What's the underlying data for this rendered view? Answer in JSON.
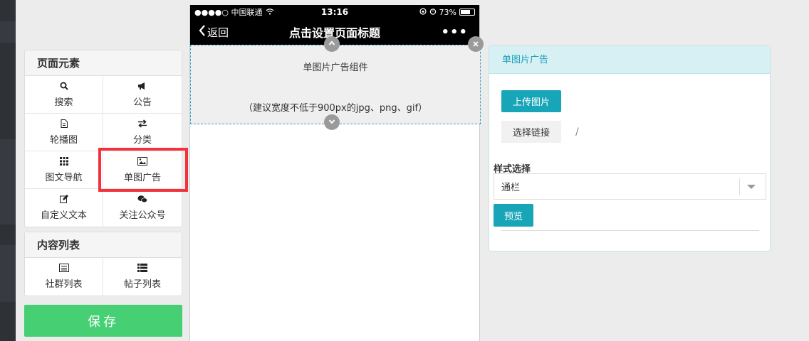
{
  "left_panel": {
    "section1_title": "页面元素",
    "section1_items": [
      {
        "label": "搜索",
        "icon": "search-icon"
      },
      {
        "label": "公告",
        "icon": "megaphone-icon"
      },
      {
        "label": "轮播图",
        "icon": "file-icon"
      },
      {
        "label": "分类",
        "icon": "exchange-icon"
      },
      {
        "label": "图文导航",
        "icon": "grid-icon"
      },
      {
        "label": "单图广告",
        "icon": "image-icon"
      },
      {
        "label": "自定义文本",
        "icon": "edit-icon"
      },
      {
        "label": "关注公众号",
        "icon": "wechat-icon"
      }
    ],
    "section2_title": "内容列表",
    "section2_items": [
      {
        "label": "社群列表",
        "icon": "list-alt-icon"
      },
      {
        "label": "帖子列表",
        "icon": "list-icon"
      }
    ],
    "save_label": "保存"
  },
  "phone": {
    "carrier": "●●●●○ 中国联通",
    "time": "13:16",
    "battery": "73%",
    "battery_level": 0.73,
    "back_label": "返回",
    "title": "点击设置页面标题",
    "more": "•••",
    "ad_title": "单图片广告组件",
    "ad_hint": "（建议宽度不低于900px的jpg、png、gif）"
  },
  "right_panel": {
    "header": "单图片广告",
    "upload_label": "上传图片",
    "link_label": "选择链接",
    "slash": "/",
    "style_label": "样式选择",
    "style_value": "通栏",
    "preview_label": "预览"
  },
  "colors": {
    "accent": "#18a5b8",
    "save": "#46cf73",
    "highlight": "#f3323c"
  }
}
